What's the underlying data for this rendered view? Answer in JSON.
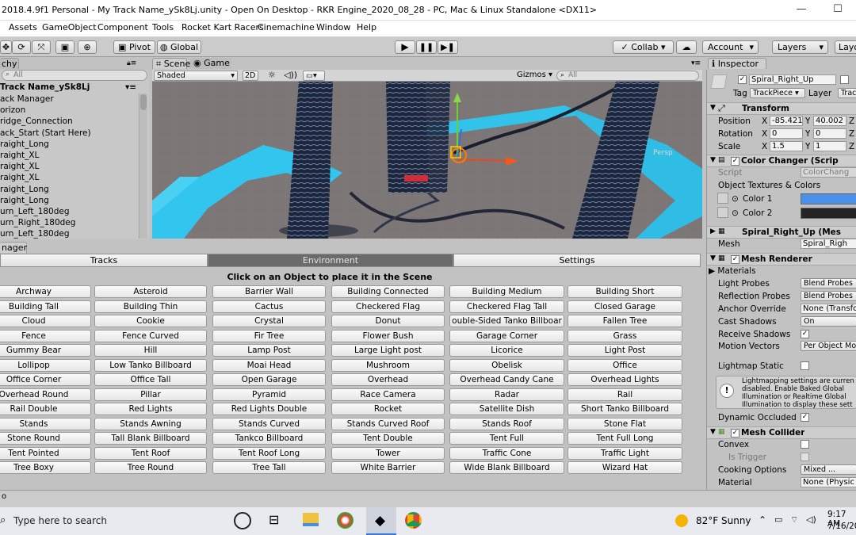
{
  "window": {
    "title": "2018.4.9f1 Personal - My Track Name_ySk8Lj.unity - Open On Desktop - RKR Engine_2020_08_28 - PC, Mac & Linux Standalone <DX11>",
    "minimize": "—",
    "maximize": "☐",
    "close": "✕"
  },
  "menu": [
    "Assets",
    "GameObject",
    "Component",
    "Tools",
    "Rocket Kart Racers",
    "Cinemachine",
    "Window",
    "Help"
  ],
  "toolbar": {
    "pivot": "Pivot",
    "global": "Global",
    "collab": "Collab ▾",
    "account": "Account",
    "layers": "Layers",
    "layout": "Layo"
  },
  "hierarchy": {
    "tab": "chy",
    "search_placeholder": "All",
    "root": "Track Name_ySk8Lj",
    "items": [
      "ack Manager",
      "orizon",
      "ridge_Connection",
      "ack_Start (Start Here)",
      "raight_Long",
      "raight_XL",
      "raight_XL",
      "raight_XL",
      "raight_Long",
      "raight_Long",
      "urn_Left_180deg",
      "urn_Right_180deg",
      "urn_Left_180deg"
    ]
  },
  "scene": {
    "tab_scene": "Scene",
    "tab_game": "Game",
    "shading": "Shaded",
    "mode_2d": "2D",
    "gizmos": "Gizmos",
    "search_placeholder": "All",
    "persp": "Persp"
  },
  "inspector": {
    "tab": "Inspector",
    "object_name": "Spiral_Right_Up",
    "tag_label": "Tag",
    "tag_value": "TrackPiece",
    "layer_label": "Layer",
    "layer_value": "Trac",
    "transform": {
      "title": "Transform",
      "position_label": "Position",
      "rotation_label": "Rotation",
      "scale_label": "Scale",
      "position": [
        "-85.421",
        "40.002"
      ],
      "rotation": [
        "0",
        "0"
      ],
      "scale": [
        "1.5",
        "1"
      ]
    },
    "color_changer": {
      "title": "Color Changer (Scrip",
      "script_label": "Script",
      "script_value": "ColorChang",
      "textures_label": "Object Textures & Colors",
      "color1_label": "Color 1",
      "color2_label": "Color 2",
      "color1": "#4a8fe8",
      "color2": "#242424"
    },
    "mesh_filter": {
      "title": "Spiral_Right_Up (Mes",
      "mesh_label": "Mesh",
      "mesh_value": "Spiral_Righ"
    },
    "mesh_renderer": {
      "title": "Mesh Renderer",
      "materials": "Materials",
      "light_probes_label": "Light Probes",
      "light_probes": "Blend Probes",
      "reflection_probes_label": "Reflection Probes",
      "reflection_probes": "Blend Probes",
      "anchor_label": "Anchor Override",
      "anchor": "None (Transfo",
      "cast_label": "Cast Shadows",
      "cast": "On",
      "receive_label": "Receive Shadows",
      "motion_label": "Motion Vectors",
      "motion": "Per Object Mot",
      "lightmap_label": "Lightmap Static",
      "info": "Lightmapping settings are curren disabled. Enable Baked Global Illumination or Realtime Global Illumination to display these sett",
      "dynamic_label": "Dynamic Occluded"
    },
    "mesh_collider": {
      "title": "Mesh Collider",
      "convex_label": "Convex",
      "trigger_label": "Is Trigger",
      "cooking_label": "Cooking Options",
      "cooking": "Mixed ...",
      "material_label": "Material",
      "material": "None (Physic"
    }
  },
  "manager": {
    "tab": "nager",
    "tabs": [
      "Tracks",
      "Environment",
      "Settings"
    ],
    "instruction": "Click on an Object to place it in the Scene",
    "objects": [
      "Archway",
      "Asteroid",
      "Barrier Wall",
      "Building Connected",
      "Building Medium",
      "Building Short",
      "Building Tall",
      "Building Thin",
      "Cactus",
      "Checkered Flag",
      "Checkered Flag Tall",
      "Closed Garage",
      "Cloud",
      "Cookie",
      "Crystal",
      "Donut",
      "ouble-Sided Tanko Billboar",
      "Fallen Tree",
      "Fence",
      "Fence Curved",
      "Fir Tree",
      "Flower Bush",
      "Garage Corner",
      "Grass",
      "Gummy Bear",
      "Hill",
      "Lamp Post",
      "Large Light post",
      "Licorice",
      "Light Post",
      "Lollipop",
      "Low Tanko Billboard",
      "Moai Head",
      "Mushroom",
      "Obelisk",
      "Office",
      "Office Corner",
      "Office Tall",
      "Open Garage",
      "Overhead",
      "Overhead Candy Cane",
      "Overhead Lights",
      "Overhead Round",
      "Pillar",
      "Pyramid",
      "Race Camera",
      "Radar",
      "Rail",
      "Rail Double",
      "Red Lights",
      "Red Lights Double",
      "Rocket",
      "Satellite Dish",
      "Short Tanko Billboard",
      "Stands",
      "Stands Awning",
      "Stands Curved",
      "Stands Curved Roof",
      "Stands Roof",
      "Stone Flat",
      "Stone Round",
      "Tall Blank Billboard",
      "Tankco Billboard",
      "Tent Double",
      "Tent Full",
      "Tent Full Long",
      "Tent Pointed",
      "Tent Roof",
      "Tent Roof Long",
      "Tower",
      "Traffic Cone",
      "Traffic Light",
      "Tree Boxy",
      "Tree Round",
      "Tree Tall",
      "White Barrier",
      "Wide Blank Billboard",
      "Wizard Hat"
    ]
  },
  "status": {
    "text": "o"
  },
  "taskbar": {
    "search": "Type here to search",
    "weather": "82°F  Sunny",
    "time": "9:17 AM",
    "date": "7/16/20"
  }
}
